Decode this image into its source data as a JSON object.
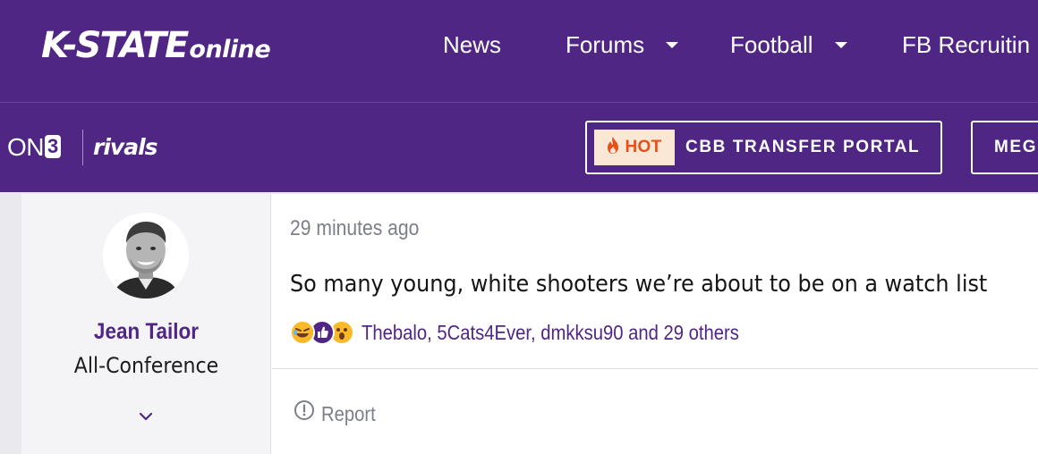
{
  "site": {
    "logo_main": "K-STATE",
    "logo_sub": "online",
    "nav": [
      {
        "label": "News",
        "has_dropdown": false
      },
      {
        "label": "Forums",
        "has_dropdown": true
      },
      {
        "label": "Football",
        "has_dropdown": true
      },
      {
        "label": "FB Recruitin",
        "has_dropdown": false
      }
    ]
  },
  "subbar": {
    "on3_prefix": "ON",
    "on3_box": "3",
    "rivals": "rivals",
    "hot_label": "HOT",
    "portal_label": "CBB TRANSFER PORTAL",
    "mega_label": "MEG"
  },
  "post": {
    "author": {
      "name": "Jean Tailor",
      "title": "All-Conference"
    },
    "timestamp": "29 minutes ago",
    "message": "So many young, white shooters we’re about to be on a watch list",
    "reactions": {
      "icons": [
        "laughing-icon",
        "like-icon",
        "wow-icon"
      ],
      "users_text": "Thebalo, 5Cats4Ever, dmkksu90 and 29 others"
    },
    "report_label": "Report"
  },
  "colors": {
    "brand_purple": "#4f2683",
    "hot_orange": "#e8501a",
    "hot_bg": "#fbe7d6",
    "muted_gray": "#7d7f88"
  }
}
